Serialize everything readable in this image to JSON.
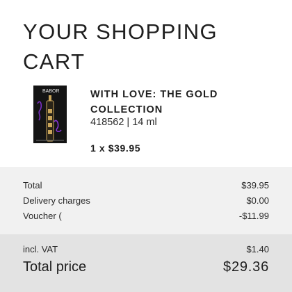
{
  "cart": {
    "title": "YOUR SHOPPING CART"
  },
  "product": {
    "name": "WITH LOVE: THE GOLD COLLECTION",
    "meta": "418562 | 14 ml",
    "quantity_price": "1 x $39.95",
    "image_brand": "BABOR"
  },
  "summary": {
    "total_label": "Total",
    "total_value": "$39.95",
    "delivery_label": "Delivery charges",
    "delivery_value": "$0.00",
    "voucher_label": "Voucher (",
    "voucher_value": "-$11.99"
  },
  "totals": {
    "vat_label": "incl. VAT",
    "vat_value": "$1.40",
    "total_price_label": "Total price",
    "total_price_value": "$29.36"
  },
  "colors": {
    "summary_bg": "#f1f1f1",
    "totals_bg": "#e3e3e3",
    "packaging_dark": "#141414",
    "packaging_script": "#7b2fc4",
    "ampoule_gold": "#c9a55a"
  }
}
